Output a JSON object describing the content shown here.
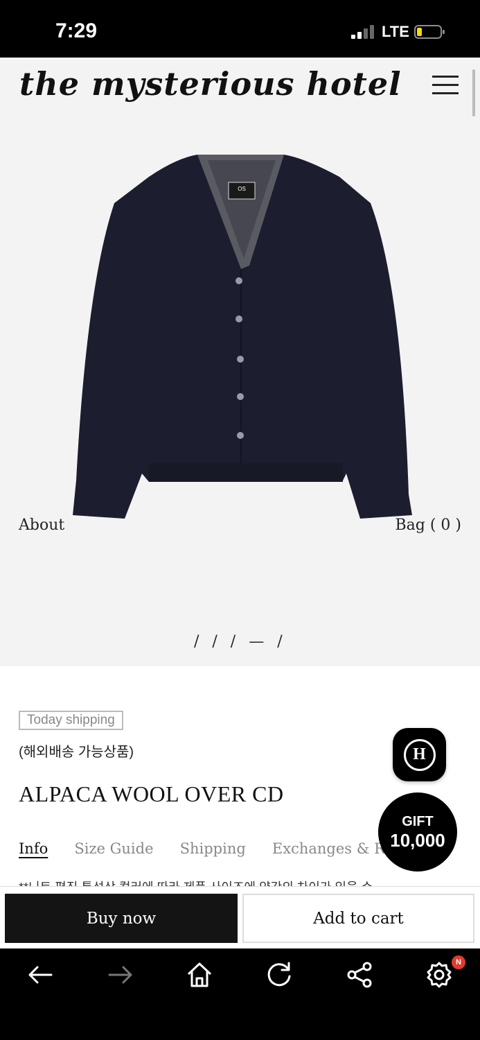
{
  "status": {
    "time": "7:29",
    "network": "LTE"
  },
  "header": {
    "logo": "the mysterious hotel"
  },
  "hero": {
    "left_link": "About",
    "right_link": "Bag ( 0 )",
    "slides_indicator": "/ / / — /",
    "garment_label": "OS"
  },
  "product": {
    "badge": "Today shipping",
    "overseas": "(해외배송 가능상품)",
    "title": "ALPACA WOOL OVER CD",
    "tabs": [
      "Info",
      "Size Guide",
      "Shipping",
      "Exchanges & Returns"
    ],
    "description_preview": "**니트 편직 특성상 컬러에 따라 제품 사이즈에 약간의 차이가 있을 수"
  },
  "floating": {
    "gift_label": "GIFT",
    "gift_amount": "10,000"
  },
  "actions": {
    "buy_now": "Buy now",
    "add_to_cart": "Add to cart"
  },
  "browser_nav": {
    "notification_badge": "N"
  },
  "colors": {
    "hero_bg": "#f3f3f3",
    "sweater": "#1c1d2e",
    "dark": "#141414",
    "notification": "#e03b2e"
  }
}
